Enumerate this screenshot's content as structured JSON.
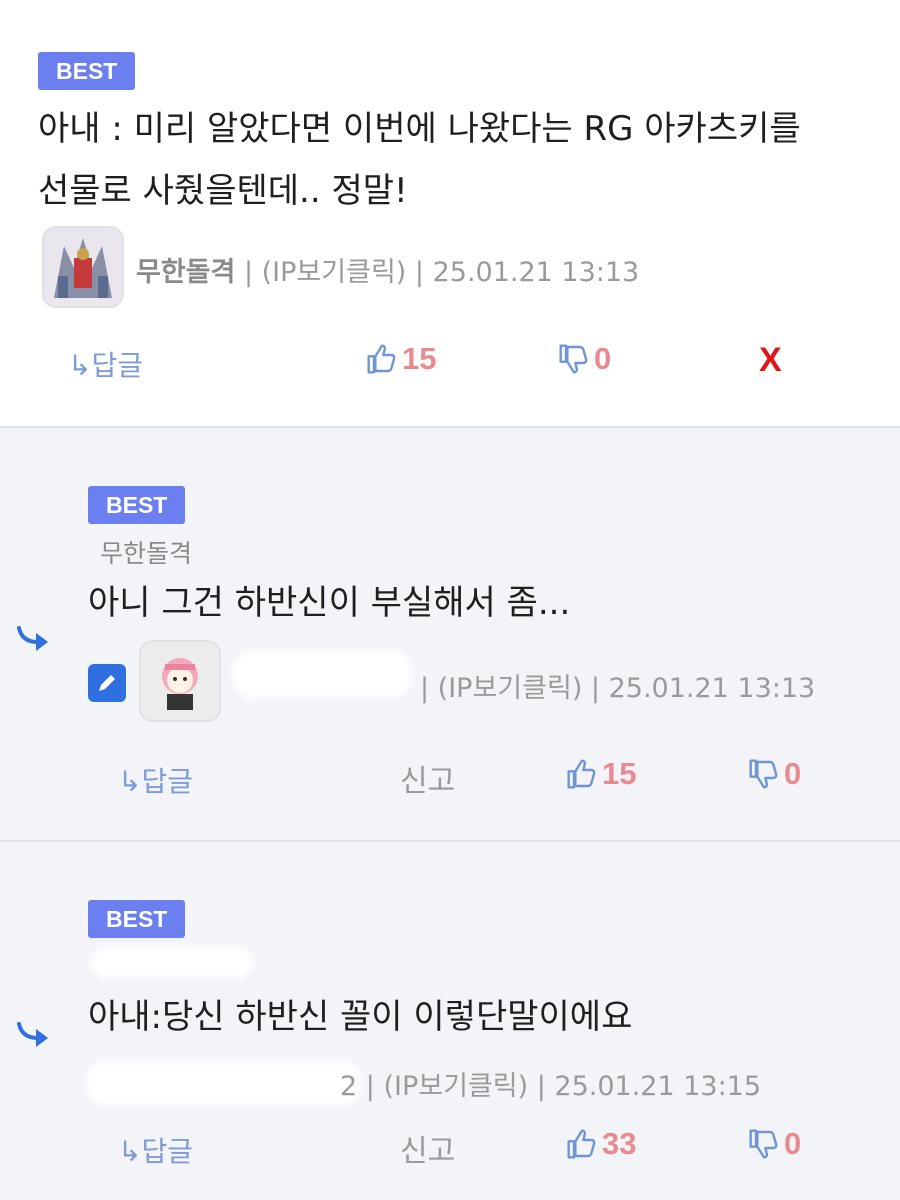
{
  "comments": [
    {
      "badge": "BEST",
      "text_line1": "아내 : 미리 알았다면 이번에 나왔다는 RG 아카츠키를",
      "text_line2": "선물로 사줬을텐데.. 정말!",
      "nickname": "무한돌격",
      "ip": "| (IP보기클릭) | 25.01.21 13:13",
      "reply_label": "↳답글",
      "up_count": "15",
      "down_count": "0",
      "delete_label": "X"
    },
    {
      "badge": "BEST",
      "parent_nickname": "무한돌격",
      "text": "아니 그건 하반신이 부실해서 좀...",
      "ip": "| (IP보기클릭) | 25.01.21 13:13",
      "reply_label": "↳답글",
      "report_label": "신고",
      "up_count": "15",
      "down_count": "0"
    },
    {
      "badge": "BEST",
      "text": "아내:당신 하반신 꼴이 이렇단말이에요",
      "ip_prefix": "2",
      "ip": "| (IP보기클릭) | 25.01.21 13:15",
      "reply_label": "↳답글",
      "report_label": "신고",
      "up_count": "33",
      "down_count": "0"
    }
  ],
  "colors": {
    "badge": "#6b7ff0",
    "count": "#e88a8f",
    "reply_bg": "#f3f4f8",
    "reply_arrow": "#2f6fe0",
    "delete": "#e21616"
  },
  "icons": [
    "thumbs-up-icon",
    "thumbs-down-icon",
    "reply-arrow-icon",
    "edit-icon",
    "avatar-image"
  ]
}
